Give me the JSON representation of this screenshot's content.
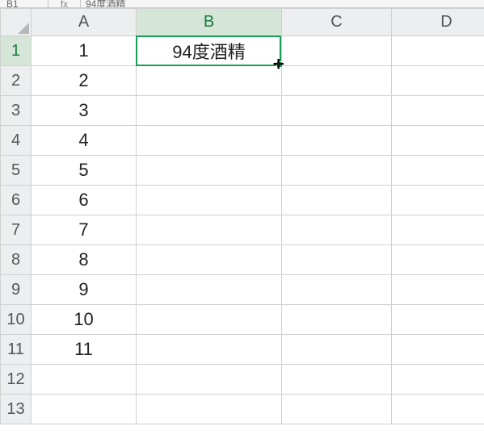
{
  "name_box": "B1",
  "fx_label": "fx",
  "formula_bar": "94度酒精",
  "columns": [
    "A",
    "B",
    "C",
    "D"
  ],
  "visible_row_count": 13,
  "active_cell": {
    "row": 1,
    "col": "B"
  },
  "cells": {
    "A1": "1",
    "A2": "2",
    "A3": "3",
    "A4": "4",
    "A5": "5",
    "A6": "6",
    "A7": "7",
    "A8": "8",
    "A9": "9",
    "A10": "10",
    "A11": "11",
    "B1": "94度酒精"
  },
  "chart_data": {
    "type": "table",
    "columns": [
      "A",
      "B"
    ],
    "rows": [
      [
        1,
        "94度酒精"
      ],
      [
        2,
        ""
      ],
      [
        3,
        ""
      ],
      [
        4,
        ""
      ],
      [
        5,
        ""
      ],
      [
        6,
        ""
      ],
      [
        7,
        ""
      ],
      [
        8,
        ""
      ],
      [
        9,
        ""
      ],
      [
        10,
        ""
      ],
      [
        11,
        ""
      ]
    ]
  }
}
